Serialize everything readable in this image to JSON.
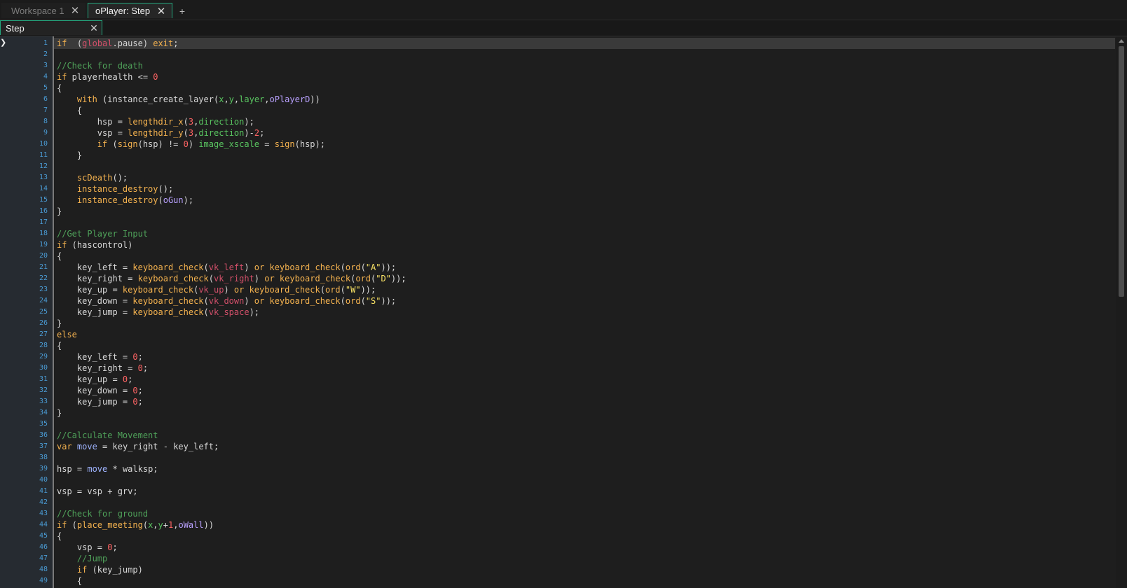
{
  "workspace_tabs": [
    {
      "label": "Workspace 1",
      "active": false
    },
    {
      "label": "oPlayer: Step",
      "active": true
    }
  ],
  "add_tab_label": "+",
  "editor_tab": {
    "label": "Step"
  },
  "current_line": 1,
  "code_lines": [
    [
      [
        "kw",
        "if"
      ],
      [
        "",
        "  ("
      ],
      [
        "res",
        "global"
      ],
      [
        "",
        ".pause) "
      ],
      [
        "kw",
        "exit"
      ],
      [
        "",
        ";"
      ]
    ],
    [],
    [
      [
        "cm",
        "//Check for death"
      ]
    ],
    [
      [
        "kw",
        "if"
      ],
      [
        "",
        " playerhealth <= "
      ],
      [
        "num",
        "0"
      ]
    ],
    [
      [
        "",
        "{"
      ]
    ],
    [
      [
        "",
        "    "
      ],
      [
        "kw",
        "with"
      ],
      [
        "",
        " (instance_create_layer("
      ],
      [
        "bi",
        "x"
      ],
      [
        "",
        ","
      ],
      [
        "bi",
        "y"
      ],
      [
        "",
        ","
      ],
      [
        "bi",
        "layer"
      ],
      [
        "",
        ","
      ],
      [
        "inst",
        "oPlayerD"
      ],
      [
        "",
        "))"
      ]
    ],
    [
      [
        "",
        "    {"
      ]
    ],
    [
      [
        "",
        "        hsp = "
      ],
      [
        "fn",
        "lengthdir_x"
      ],
      [
        "",
        "("
      ],
      [
        "num",
        "3"
      ],
      [
        "",
        ","
      ],
      [
        "bi",
        "direction"
      ],
      [
        "",
        ");"
      ]
    ],
    [
      [
        "",
        "        vsp = "
      ],
      [
        "fn",
        "lengthdir_y"
      ],
      [
        "",
        "("
      ],
      [
        "num",
        "3"
      ],
      [
        "",
        ","
      ],
      [
        "bi",
        "direction"
      ],
      [
        "",
        ")-"
      ],
      [
        "num",
        "2"
      ],
      [
        "",
        ";"
      ]
    ],
    [
      [
        "",
        "        "
      ],
      [
        "kw",
        "if"
      ],
      [
        "",
        " ("
      ],
      [
        "fn",
        "sign"
      ],
      [
        "",
        "(hsp) != "
      ],
      [
        "num",
        "0"
      ],
      [
        "",
        ") "
      ],
      [
        "bi",
        "image_xscale"
      ],
      [
        "",
        " = "
      ],
      [
        "fn",
        "sign"
      ],
      [
        "",
        "(hsp);"
      ]
    ],
    [
      [
        "",
        "    }"
      ]
    ],
    [],
    [
      [
        "",
        "    "
      ],
      [
        "fn",
        "scDeath"
      ],
      [
        "",
        "();"
      ]
    ],
    [
      [
        "",
        "    "
      ],
      [
        "fn",
        "instance_destroy"
      ],
      [
        "",
        "();"
      ]
    ],
    [
      [
        "",
        "    "
      ],
      [
        "fn",
        "instance_destroy"
      ],
      [
        "",
        "("
      ],
      [
        "inst",
        "oGun"
      ],
      [
        "",
        ");"
      ]
    ],
    [
      [
        "",
        "}"
      ]
    ],
    [],
    [
      [
        "cm",
        "//Get Player Input"
      ]
    ],
    [
      [
        "kw",
        "if"
      ],
      [
        "",
        " (hascontrol)"
      ]
    ],
    [
      [
        "",
        "{"
      ]
    ],
    [
      [
        "",
        "    key_left = "
      ],
      [
        "fn",
        "keyboard_check"
      ],
      [
        "",
        "("
      ],
      [
        "res",
        "vk_left"
      ],
      [
        "",
        ") "
      ],
      [
        "kw",
        "or"
      ],
      [
        "",
        " "
      ],
      [
        "fn",
        "keyboard_check"
      ],
      [
        "",
        "("
      ],
      [
        "fn",
        "ord"
      ],
      [
        "",
        "("
      ],
      [
        "str",
        "\"A\""
      ],
      [
        "",
        "));"
      ]
    ],
    [
      [
        "",
        "    key_right = "
      ],
      [
        "fn",
        "keyboard_check"
      ],
      [
        "",
        "("
      ],
      [
        "res",
        "vk_right"
      ],
      [
        "",
        ") "
      ],
      [
        "kw",
        "or"
      ],
      [
        "",
        " "
      ],
      [
        "fn",
        "keyboard_check"
      ],
      [
        "",
        "("
      ],
      [
        "fn",
        "ord"
      ],
      [
        "",
        "("
      ],
      [
        "str",
        "\"D\""
      ],
      [
        "",
        "));"
      ]
    ],
    [
      [
        "",
        "    key_up = "
      ],
      [
        "fn",
        "keyboard_check"
      ],
      [
        "",
        "("
      ],
      [
        "res",
        "vk_up"
      ],
      [
        "",
        ") "
      ],
      [
        "kw",
        "or"
      ],
      [
        "",
        " "
      ],
      [
        "fn",
        "keyboard_check"
      ],
      [
        "",
        "("
      ],
      [
        "fn",
        "ord"
      ],
      [
        "",
        "("
      ],
      [
        "str",
        "\"W\""
      ],
      [
        "",
        "));"
      ]
    ],
    [
      [
        "",
        "    key_down = "
      ],
      [
        "fn",
        "keyboard_check"
      ],
      [
        "",
        "("
      ],
      [
        "res",
        "vk_down"
      ],
      [
        "",
        ") "
      ],
      [
        "kw",
        "or"
      ],
      [
        "",
        " "
      ],
      [
        "fn",
        "keyboard_check"
      ],
      [
        "",
        "("
      ],
      [
        "fn",
        "ord"
      ],
      [
        "",
        "("
      ],
      [
        "str",
        "\"S\""
      ],
      [
        "",
        "));"
      ]
    ],
    [
      [
        "",
        "    key_jump = "
      ],
      [
        "fn",
        "keyboard_check"
      ],
      [
        "",
        "("
      ],
      [
        "res",
        "vk_space"
      ],
      [
        "",
        ");"
      ]
    ],
    [
      [
        "",
        "}"
      ]
    ],
    [
      [
        "kw",
        "else"
      ]
    ],
    [
      [
        "",
        "{"
      ]
    ],
    [
      [
        "",
        "    key_left = "
      ],
      [
        "num",
        "0"
      ],
      [
        "",
        ";"
      ]
    ],
    [
      [
        "",
        "    key_right = "
      ],
      [
        "num",
        "0"
      ],
      [
        "",
        ";"
      ]
    ],
    [
      [
        "",
        "    key_up = "
      ],
      [
        "num",
        "0"
      ],
      [
        "",
        ";"
      ]
    ],
    [
      [
        "",
        "    key_down = "
      ],
      [
        "num",
        "0"
      ],
      [
        "",
        ";"
      ]
    ],
    [
      [
        "",
        "    key_jump = "
      ],
      [
        "num",
        "0"
      ],
      [
        "",
        ";"
      ]
    ],
    [
      [
        "",
        "}"
      ]
    ],
    [],
    [
      [
        "cm",
        "//Calculate Movement"
      ]
    ],
    [
      [
        "kw",
        "var"
      ],
      [
        "",
        " "
      ],
      [
        "var",
        "move"
      ],
      [
        "",
        " = key_right - key_left;"
      ]
    ],
    [],
    [
      [
        "",
        "hsp = "
      ],
      [
        "var",
        "move"
      ],
      [
        "",
        " * walksp;"
      ]
    ],
    [],
    [
      [
        "",
        "vsp = vsp + grv;"
      ]
    ],
    [],
    [
      [
        "cm",
        "//Check for ground"
      ]
    ],
    [
      [
        "kw",
        "if"
      ],
      [
        "",
        " ("
      ],
      [
        "fn",
        "place_meeting"
      ],
      [
        "",
        "("
      ],
      [
        "bi",
        "x"
      ],
      [
        "",
        ","
      ],
      [
        "bi",
        "y"
      ],
      [
        "",
        "+"
      ],
      [
        "num",
        "1"
      ],
      [
        "",
        ","
      ],
      [
        "inst",
        "oWall"
      ],
      [
        "",
        "))"
      ]
    ],
    [
      [
        "",
        "{"
      ]
    ],
    [
      [
        "",
        "    vsp = "
      ],
      [
        "num",
        "0"
      ],
      [
        "",
        ";"
      ]
    ],
    [
      [
        "",
        "    "
      ],
      [
        "cm",
        "//Jump"
      ]
    ],
    [
      [
        "",
        "    "
      ],
      [
        "kw",
        "if"
      ],
      [
        "",
        " (key_jump)"
      ]
    ],
    [
      [
        "",
        "    {"
      ]
    ]
  ],
  "colors": {
    "keyword": "#f4b24f",
    "function": "#f4b24f",
    "number": "#ff6464",
    "comment": "#4fa25a",
    "string": "#fce566",
    "resource": "#d3506a",
    "local_var": "#9fb4ff",
    "builtin": "#59c460",
    "instance": "#b9a1ff",
    "accent": "#23a77e",
    "line_number": "#4a9bd4"
  }
}
